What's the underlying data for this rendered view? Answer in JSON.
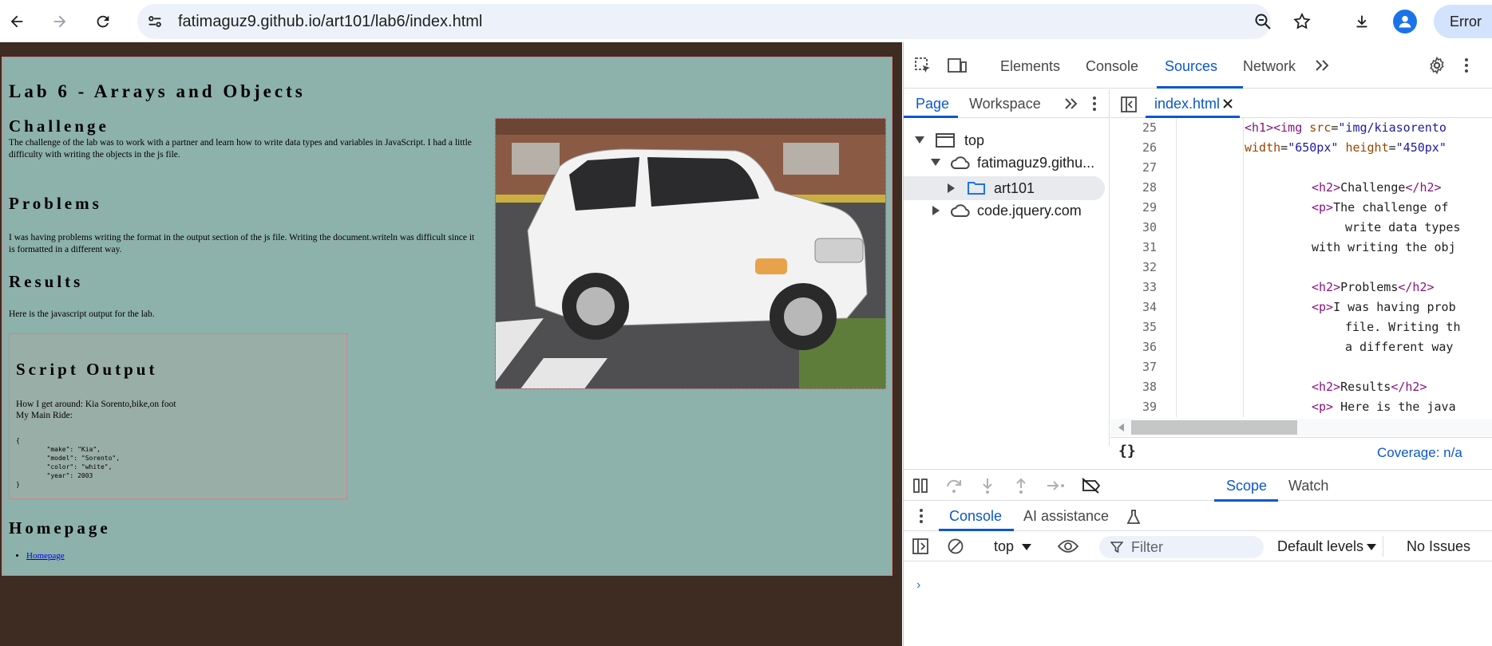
{
  "browser": {
    "url": "fatimaguz9.github.io/art101/lab6/index.html",
    "error_label": "Error"
  },
  "page": {
    "title": "Lab 6 - Arrays and Objects",
    "challenge_heading": "Challenge",
    "challenge_text": "The challenge of the lab was to work with a partner and learn how to write data types and variables in JavaScript. I had a little difficulty with writing the objects in the js file.",
    "problems_heading": "Problems",
    "problems_text": "I was having problems writing the format in the output section of the js file. Writing the document.writeln was difficult since it is formatted in a different way.",
    "results_heading": "Results",
    "results_text": "Here is the javascript output for the lab.",
    "script_heading": "Script Output",
    "script_line1": "How I get around: Kia Sorento,bike,on foot",
    "script_line2": "My Main Ride:",
    "script_json": "{\n        \"make\": \"Kia\",\n        \"model\": \"Sorento\",\n        \"color\": \"white\",\n        \"year\": 2003\n}",
    "homepage_heading": "Homepage",
    "homepage_link": "Homepage"
  },
  "devtools": {
    "tabs": [
      "Elements",
      "Console",
      "Sources",
      "Network"
    ],
    "active_tab": "Sources",
    "nav_subtabs": [
      "Page",
      "Workspace"
    ],
    "tree": {
      "top": "top",
      "domain1": "fatimaguz9.githu...",
      "folder": "art101",
      "domain2": "code.jquery.com"
    },
    "open_file": "index.html",
    "code_lines": [
      {
        "n": "25",
        "indent": 168,
        "html": "<span class='tag'>&lt;h1&gt;&lt;img</span> <span class='attr'>src</span>=<span class='val'>\"img/kiasorento</span>"
      },
      {
        "n": "26",
        "indent": 168,
        "html": "<span class='attr'>width</span>=<span class='val'>\"650px\"</span> <span class='attr'>height</span>=<span class='val'>\"450px\"</span>"
      },
      {
        "n": "27",
        "indent": 168,
        "html": ""
      },
      {
        "n": "28",
        "indent": 252,
        "html": "<span class='tag'>&lt;h2&gt;</span>Challenge<span class='tag'>&lt;/h2&gt;</span>"
      },
      {
        "n": "29",
        "indent": 252,
        "html": "<span class='tag'>&lt;p&gt;</span>The challenge of"
      },
      {
        "n": "30",
        "indent": 294,
        "html": "write data types"
      },
      {
        "n": "31",
        "indent": 252,
        "html": "with writing the obj"
      },
      {
        "n": "32",
        "indent": 252,
        "html": ""
      },
      {
        "n": "33",
        "indent": 252,
        "html": "<span class='tag'>&lt;h2&gt;</span>Problems<span class='tag'>&lt;/h2&gt;</span>"
      },
      {
        "n": "34",
        "indent": 252,
        "html": "<span class='tag'>&lt;p&gt;</span>I was having prob"
      },
      {
        "n": "35",
        "indent": 294,
        "html": "file. Writing th"
      },
      {
        "n": "36",
        "indent": 294,
        "html": "a different way"
      },
      {
        "n": "37",
        "indent": 252,
        "html": ""
      },
      {
        "n": "38",
        "indent": 252,
        "html": "<span class='tag'>&lt;h2&gt;</span>Results<span class='tag'>&lt;/h2&gt;</span>"
      },
      {
        "n": "39",
        "indent": 252,
        "html": "<span class='tag'>&lt;p&gt;</span> Here is the java"
      }
    ],
    "coverage": "Coverage: n/a",
    "scope_tab": "Scope",
    "watch_tab": "Watch",
    "console_tab": "Console",
    "ai_tab": "AI assistance",
    "context": "top",
    "filter_placeholder": "Filter",
    "levels": "Default levels",
    "issues": "No Issues"
  }
}
